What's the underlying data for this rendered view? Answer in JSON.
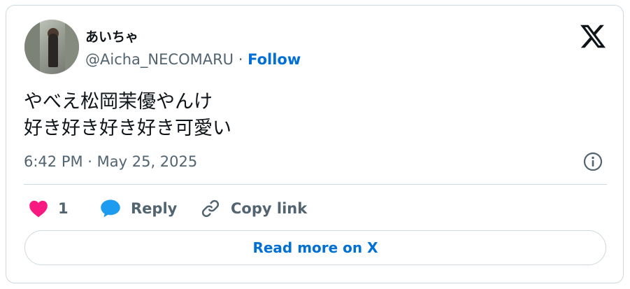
{
  "tweet": {
    "author_name": "あいちゃ",
    "handle": "@Aicha_NECOMARU",
    "separator": " · ",
    "follow_label": "Follow",
    "text_line1": "やべえ松岡茉優やんけ",
    "text_line2": "好き好き好き好き可愛い",
    "timestamp": "6:42 PM · May 25, 2025"
  },
  "actions": {
    "like_count": "1",
    "reply_label": "Reply",
    "copy_label": "Copy link"
  },
  "read_more_label": "Read more on X",
  "icons": {
    "logo": "x-logo-icon",
    "info": "info-icon",
    "like": "heart-icon",
    "reply": "speech-bubble-icon",
    "copy": "link-icon"
  },
  "colors": {
    "accent": "#006fd6",
    "like": "#f91880",
    "reply": "#1d9bf0",
    "secondary_text": "#536471",
    "border": "#cfd9de"
  }
}
